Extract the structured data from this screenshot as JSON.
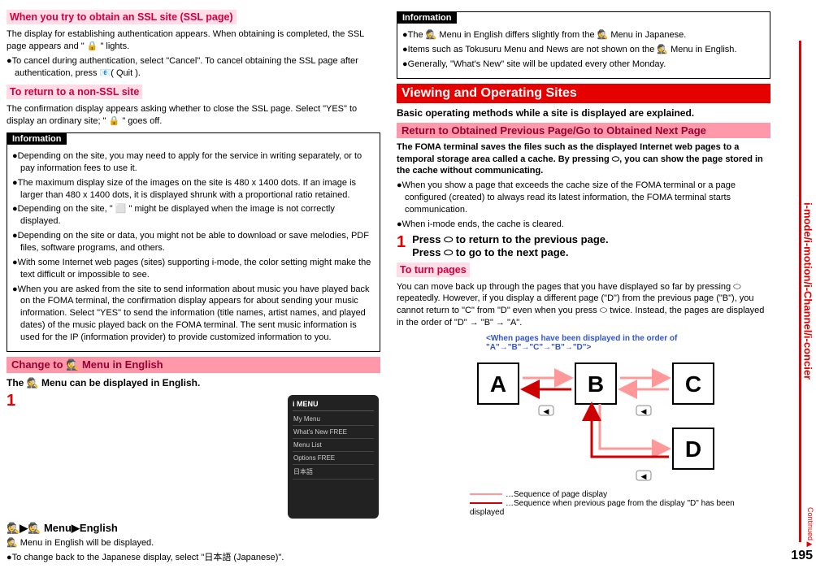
{
  "leftCol": {
    "h_ssl": "When you try to obtain an SSL site (SSL page)",
    "p_ssl1": "The display for establishing authentication appears. When obtaining is completed, the SSL page appears and \" 🔒 \" lights.",
    "p_ssl2": "●To cancel during authentication, select \"Cancel\". To cancel obtaining the SSL page after authentication, press 📧( Quit ).",
    "h_nonssl": "To return to a non-SSL site",
    "p_nonssl": "The confirmation display appears asking whether to close the SSL page. Select \"YES\" to display an ordinary site; \" 🔒 \" goes off.",
    "info1_title": "Information",
    "info1_b1": "●Depending on the site, you may need to apply for the service in writing separately, or to pay information fees to use it.",
    "info1_b2": "●The maximum display size of the images on the site is 480 x 1400 dots. If an image is larger than 480 x 1400 dots, it is displayed shrunk with a proportional ratio retained.",
    "info1_b3": "●Depending on the site, \" ⬜ \" might be displayed when the image is not correctly displayed.",
    "info1_b4": "●Depending on the site or data, you might not be able to download or save melodies, PDF files, software programs, and others.",
    "info1_b5": "●With some Internet web pages (sites) supporting i-mode, the color setting might make the text difficult or impossible to see.",
    "info1_b6": "●When you are asked from the site to send information about music you have played back on the FOMA terminal, the confirmation display appears for about sending your music information. Select \"YES\" to send the information (title names, artist names, and played dates) of the music played back on the FOMA terminal. The sent music information is used for the IP (information provider) to provide customized information to you.",
    "h_change": "Change to 🕵 Menu in English",
    "p_change_sub": "The 🕵 Menu can be displayed in English.",
    "step1_title": "🕵▶🕵 Menu▶English",
    "step1_body1": "🕵 Menu in English will be displayed.",
    "step1_body2": "●To change back to the Japanese display, select \"日本語 (Japanese)\".",
    "phone_menu": {
      "title": "i MENU",
      "items": [
        "My Menu",
        "What's New FREE",
        "Menu List",
        "Options FREE",
        "日本語"
      ]
    }
  },
  "rightCol": {
    "info2_title": "Information",
    "info2_b1": "●The 🕵 Menu in English differs slightly from the 🕵 Menu in Japanese.",
    "info2_b2": "●Items such as Tokusuru Menu and News are not shown on the 🕵 Menu in English.",
    "info2_b3": "●Generally, \"What's New\" site will be updated every other Monday.",
    "h_viewing": "Viewing and Operating Sites",
    "p_viewing_sub": "Basic operating methods while a site is displayed are explained.",
    "h_return": "Return to Obtained Previous Page/Go to Obtained Next Page",
    "p_return1": "The FOMA terminal saves the files such as the displayed Internet web pages to a temporal storage area called a cache. By pressing ⬭, you can show the page stored in the cache without communicating.",
    "p_return2": "●When you show a page that exceeds the cache size of the FOMA terminal or a page configured (created) to always read its latest information, the FOMA terminal starts communication.",
    "p_return3": "●When i-mode ends, the cache is cleared.",
    "step1r_a": "Press ⬭ to return to the previous page.",
    "step1r_b": "Press ⬭ to go to the next page.",
    "h_turn": "To turn pages",
    "p_turn": "You can move back up through the pages that you have displayed so far by pressing ⬭ repeatedly. However, if you display a different page (\"D\") from the previous page (\"B\"), you cannot return to \"C\" from \"D\" even when you press ⬭ twice. Instead, the pages are displayed in the order of \"D\" → \"B\" → \"A\".",
    "dg_title": "<When pages have been displayed in the order of \"A\"→\"B\"→\"C\"→\"B\"→\"D\">",
    "legend_pink": "…Sequence of page display",
    "legend_red": "…Sequence when previous page from the display \"D\" has been displayed"
  },
  "sidebar": "i-mode/i-motion/i-Channel/i-concier",
  "pagenum": "195",
  "continued": "Continued▶",
  "diagram_labels": {
    "A": "A",
    "B": "B",
    "C": "C",
    "D": "D"
  }
}
